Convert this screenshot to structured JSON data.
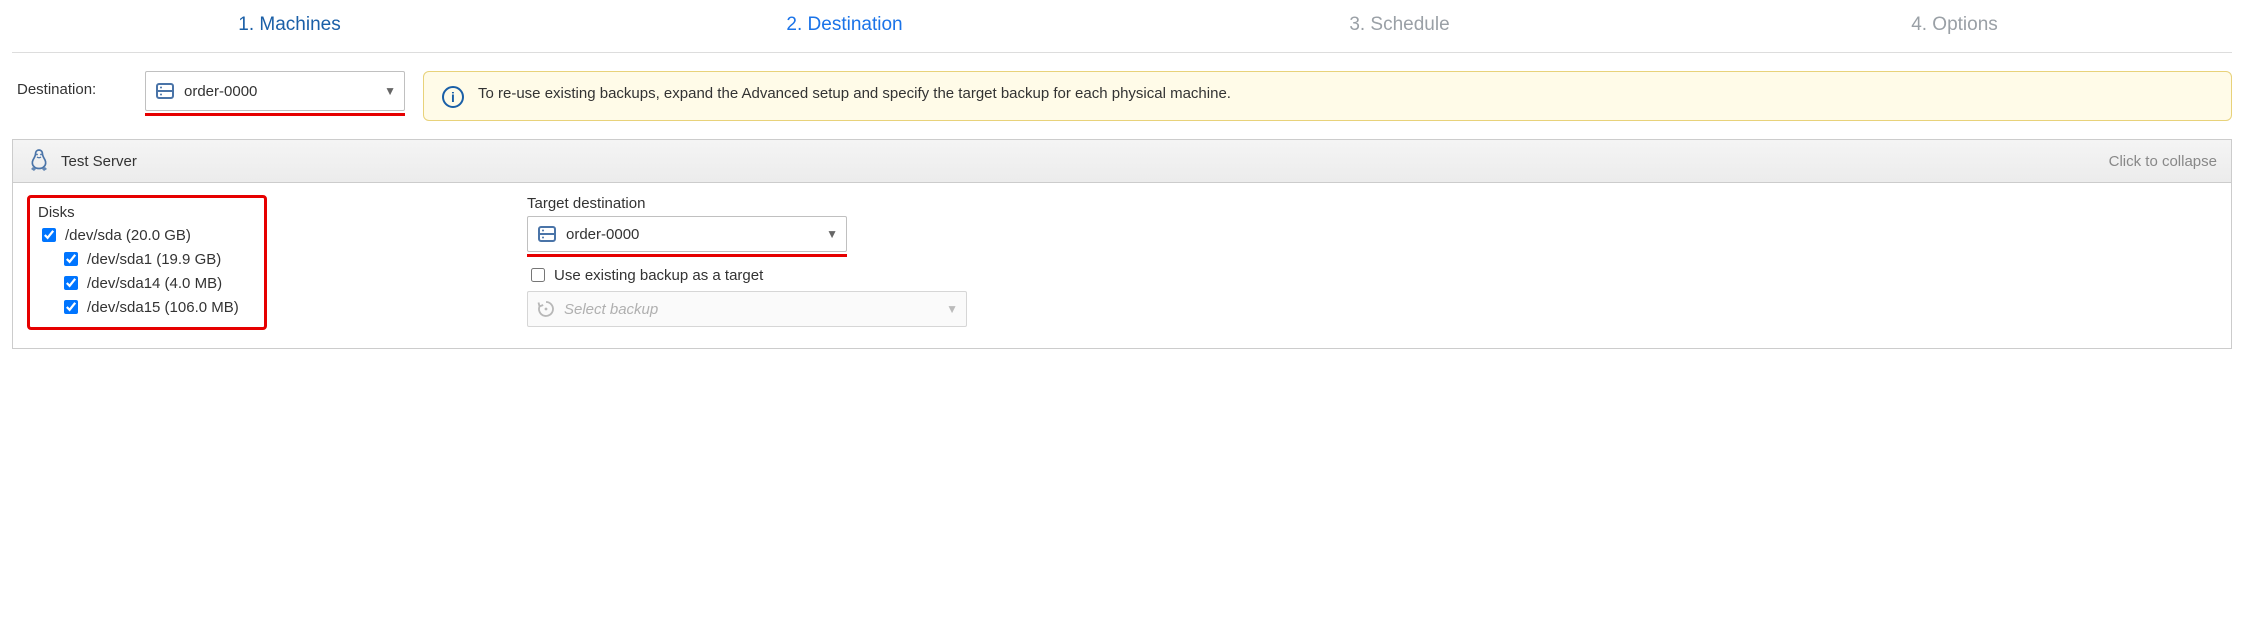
{
  "steps": {
    "s1": "1. Machines",
    "s2": "2. Destination",
    "s3": "3. Schedule",
    "s4": "4. Options"
  },
  "destination": {
    "label": "Destination:",
    "selected": "order-0000"
  },
  "info": {
    "text": "To re-use existing backups, expand the Advanced setup and specify the target backup for each physical machine."
  },
  "server": {
    "name": "Test Server",
    "collapse_hint": "Click to collapse"
  },
  "disks": {
    "title": "Disks",
    "root": "/dev/sda (20.0 GB)",
    "sda1": "/dev/sda1 (19.9 GB)",
    "sda14": "/dev/sda14 (4.0 MB)",
    "sda15": "/dev/sda15 (106.0 MB)"
  },
  "target": {
    "label": "Target destination",
    "selected": "order-0000",
    "use_existing_label": "Use existing backup as a target",
    "select_backup_placeholder": "Select backup"
  }
}
